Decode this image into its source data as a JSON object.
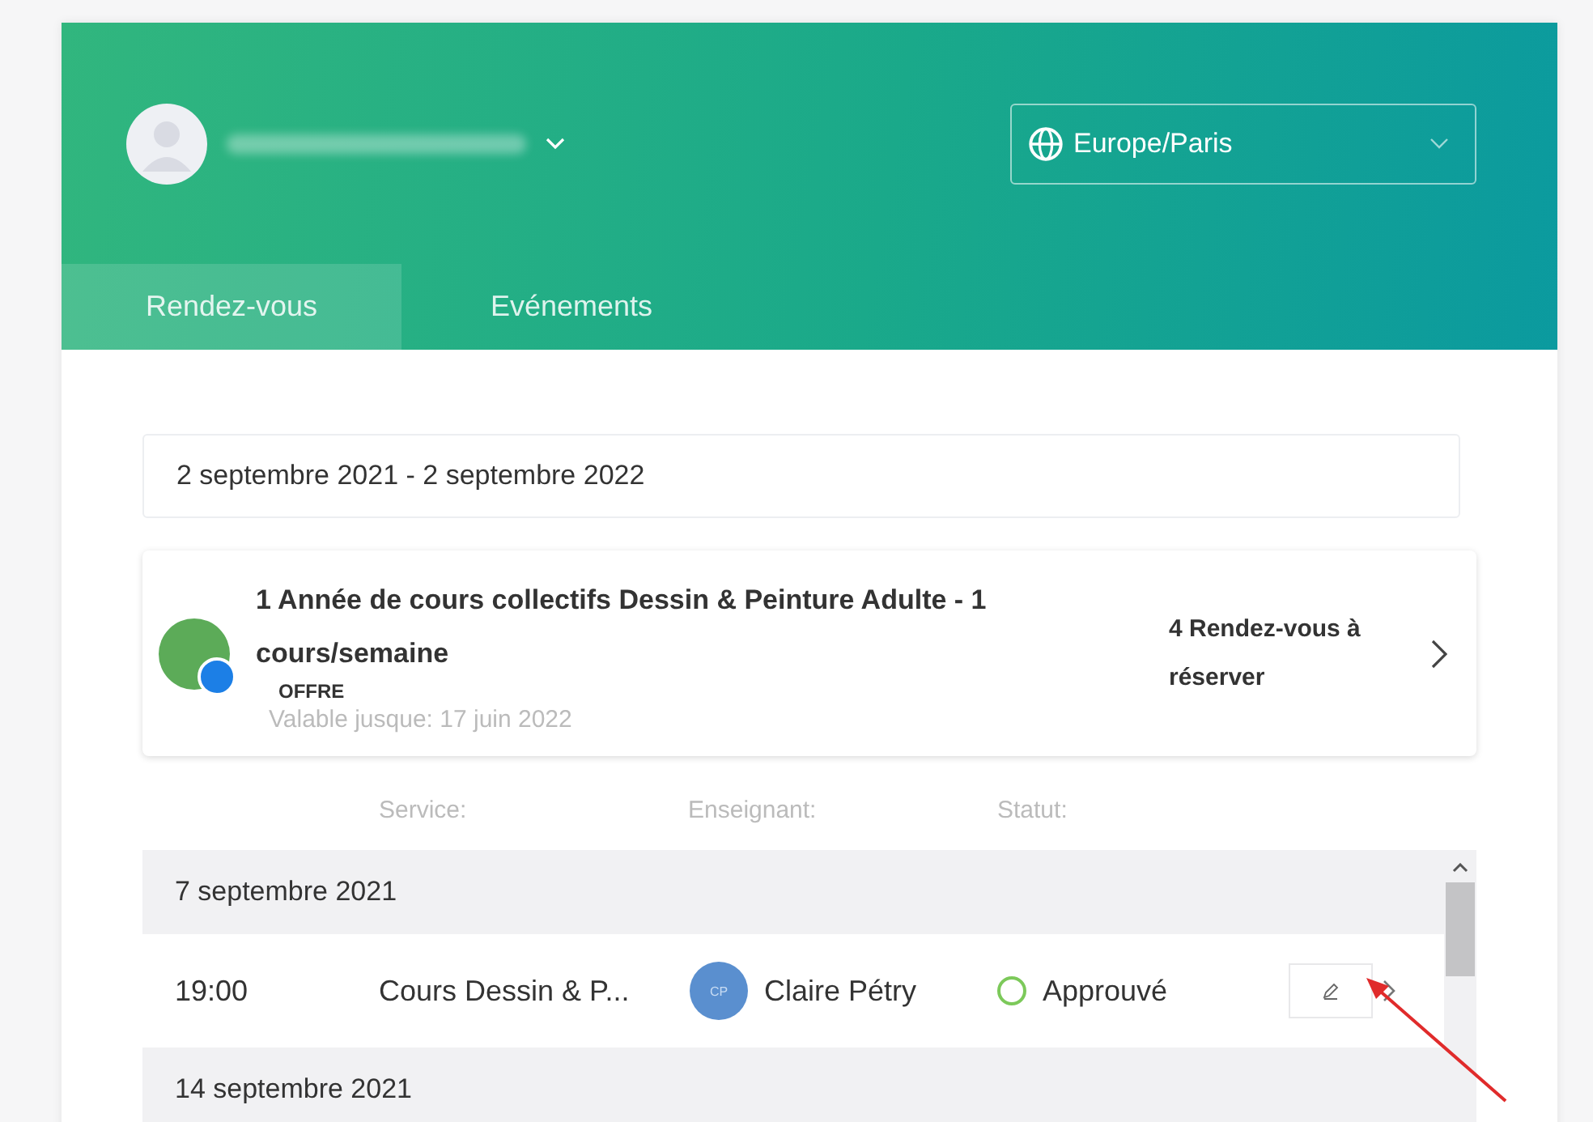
{
  "timezone": {
    "value": "Europe/Paris"
  },
  "tabs": [
    {
      "label": "Rendez-vous",
      "selected": true
    },
    {
      "label": "Evénements",
      "selected": false
    }
  ],
  "date_range": "2 septembre 2021 - 2 septembre 2022",
  "offer": {
    "title": "1 Année de cours collectifs Dessin & Peinture Adulte - 1 cours/semaine",
    "badge": "OFFRE",
    "validity": "Valable jusque: 17 juin 2022",
    "remaining": "4 Rendez-vous à réserver"
  },
  "columns": [
    "Service:",
    "Enseignant:",
    "Statut:"
  ],
  "groups": [
    {
      "date": "7 septembre 2021",
      "appointments": [
        {
          "time": "19:00",
          "service": "Cours Dessin & P...",
          "teacher_initials": "CP",
          "teacher": "Claire Pétry",
          "status": {
            "label": "Approuvé",
            "kind": "approved"
          }
        }
      ]
    },
    {
      "date": "14 septembre 2021"
    }
  ]
}
